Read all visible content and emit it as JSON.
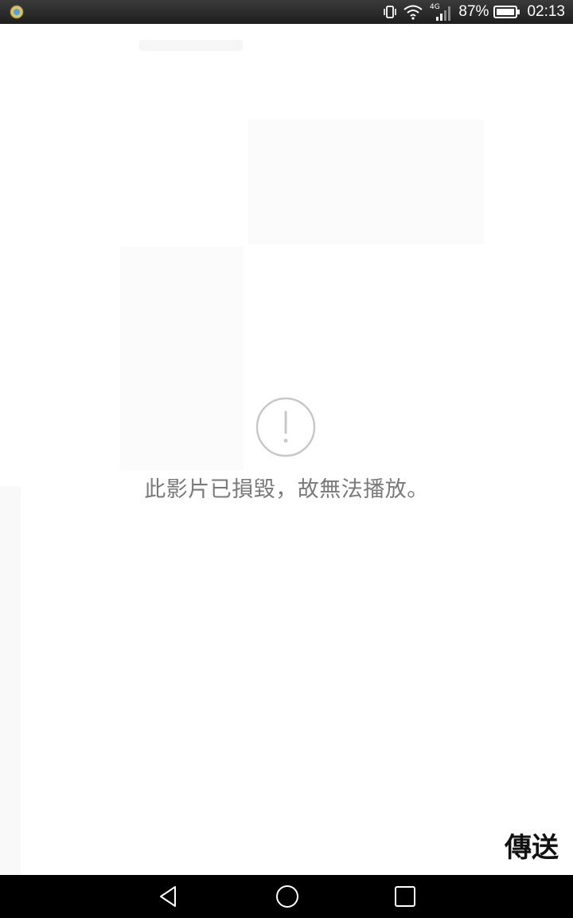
{
  "status_bar": {
    "battery": "87%",
    "time": "02:13",
    "network": "4G"
  },
  "video": {
    "error_message": "此影片已損毀，故無法播放。",
    "error_icon": "alert-circle-icon"
  },
  "actions": {
    "send_label": "傳送"
  },
  "nav": {
    "back_icon": "back-triangle-icon",
    "home_icon": "home-circle-icon",
    "recent_icon": "recent-square-icon"
  },
  "colors": {
    "message_text": "#7a7a7a",
    "icon_stroke": "#c8c8c8",
    "nav_background": "#000000"
  }
}
